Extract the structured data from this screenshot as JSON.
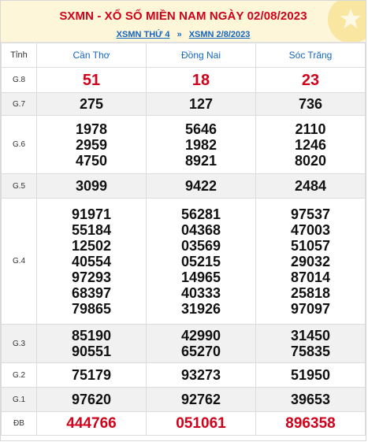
{
  "header": {
    "title": "SXMN - XỔ SỐ MIỀN NAM NGÀY 02/08/2023",
    "link1": "XSMN THỨ 4",
    "separator": "»",
    "link2": "XSMN 2/8/2023"
  },
  "table": {
    "header_label": "Tỉnh",
    "provinces": [
      "Cần Thơ",
      "Đồng Nai",
      "Sóc Trăng"
    ],
    "rows": [
      {
        "label": "G.8",
        "values": [
          [
            "51"
          ],
          [
            "18"
          ],
          [
            "23"
          ]
        ]
      },
      {
        "label": "G.7",
        "values": [
          [
            "275"
          ],
          [
            "127"
          ],
          [
            "736"
          ]
        ]
      },
      {
        "label": "G.6",
        "values": [
          [
            "1978",
            "2959",
            "4750"
          ],
          [
            "5646",
            "1982",
            "8921"
          ],
          [
            "2110",
            "1246",
            "8020"
          ]
        ]
      },
      {
        "label": "G.5",
        "values": [
          [
            "3099"
          ],
          [
            "9422"
          ],
          [
            "2484"
          ]
        ]
      },
      {
        "label": "G.4",
        "values": [
          [
            "91971",
            "55184",
            "12502",
            "40554",
            "97293",
            "68397",
            "79865"
          ],
          [
            "56281",
            "04368",
            "03569",
            "05215",
            "14965",
            "40333",
            "31926"
          ],
          [
            "97537",
            "47003",
            "51057",
            "29032",
            "87014",
            "25818",
            "97097"
          ]
        ]
      },
      {
        "label": "G.3",
        "values": [
          [
            "85190",
            "90551"
          ],
          [
            "42990",
            "65270"
          ],
          [
            "31450",
            "75835"
          ]
        ]
      },
      {
        "label": "G.2",
        "values": [
          [
            "75179"
          ],
          [
            "93273"
          ],
          [
            "51950"
          ]
        ]
      },
      {
        "label": "G.1",
        "values": [
          [
            "97620"
          ],
          [
            "92762"
          ],
          [
            "39653"
          ]
        ]
      },
      {
        "label": "ĐB",
        "values": [
          [
            "444766"
          ],
          [
            "051061"
          ],
          [
            "896358"
          ]
        ]
      }
    ]
  },
  "colors": {
    "accent_red": "#d0021b",
    "link_blue": "#1565c0",
    "header_bg": "#fdf6d8"
  }
}
